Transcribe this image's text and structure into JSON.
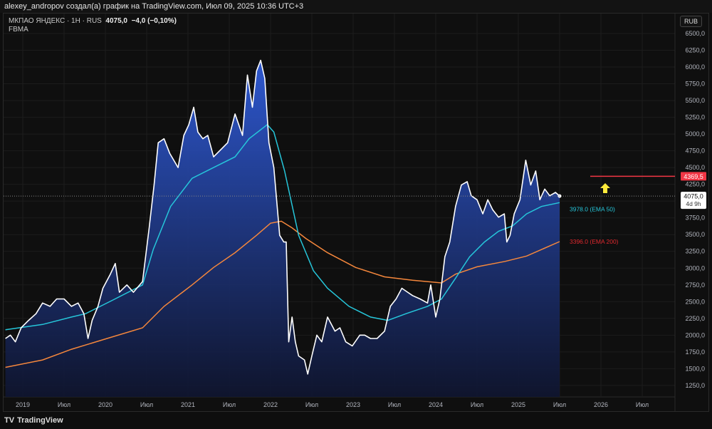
{
  "header": {
    "caption": "alexey_andropov создал(а) график на TradingView.com, Июл 09, 2025 10:36 UTC+3"
  },
  "legend": {
    "symbol": "МКПАО ЯНДЕКС · 1Н · RUS",
    "price": "4075,0",
    "change": "−4,0 (−0,10%)",
    "indicator": "FBMA"
  },
  "currency": "RUB",
  "footer": {
    "brand": "TradingView"
  },
  "colors": {
    "price": "#ffffff",
    "ema50": "#26c6da",
    "ema200": "#f5873c",
    "alert": "#f23645",
    "arrow": "#ffeb3b",
    "fill_top": "#2f5bd8",
    "fill_bottom": "#0f1530"
  },
  "chart_data": {
    "type": "area",
    "ylim": [
      1125,
      6600
    ],
    "y_ticks": [
      "6500,0",
      "6250,0",
      "6000,0",
      "5750,0",
      "5500,0",
      "5250,0",
      "5000,0",
      "4750,0",
      "4500,0",
      "4250,0",
      "4000,0",
      "3750,0",
      "3500,0",
      "3250,0",
      "3000,0",
      "2750,0",
      "2500,0",
      "2250,0",
      "2000,0",
      "1750,0",
      "1500,0",
      "1250,0"
    ],
    "y_tick_values": [
      6500,
      6250,
      6000,
      5750,
      5500,
      5250,
      5000,
      4750,
      4500,
      4250,
      4000,
      3750,
      3500,
      3250,
      3000,
      2750,
      2500,
      2250,
      2000,
      1750,
      1500,
      1250
    ],
    "x_ticks": [
      {
        "t": 2019.0,
        "label": "2019"
      },
      {
        "t": 2019.5,
        "label": "Июл"
      },
      {
        "t": 2020.0,
        "label": "2020"
      },
      {
        "t": 2020.5,
        "label": "Июл"
      },
      {
        "t": 2021.0,
        "label": "2021"
      },
      {
        "t": 2021.5,
        "label": "Июл"
      },
      {
        "t": 2022.0,
        "label": "2022"
      },
      {
        "t": 2022.5,
        "label": "Июл"
      },
      {
        "t": 2023.0,
        "label": "2023"
      },
      {
        "t": 2023.5,
        "label": "Июл"
      },
      {
        "t": 2024.0,
        "label": "2024"
      },
      {
        "t": 2024.5,
        "label": "Июл"
      },
      {
        "t": 2025.0,
        "label": "2025"
      },
      {
        "t": 2025.5,
        "label": "Июл"
      },
      {
        "t": 2026.0,
        "label": "2026"
      },
      {
        "t": 2026.5,
        "label": "Июл"
      }
    ],
    "price": [
      [
        2018.79,
        1950
      ],
      [
        2018.85,
        2000
      ],
      [
        2018.91,
        1900
      ],
      [
        2018.98,
        2110
      ],
      [
        2019.07,
        2220
      ],
      [
        2019.16,
        2320
      ],
      [
        2019.24,
        2480
      ],
      [
        2019.33,
        2430
      ],
      [
        2019.41,
        2540
      ],
      [
        2019.5,
        2540
      ],
      [
        2019.59,
        2430
      ],
      [
        2019.67,
        2480
      ],
      [
        2019.74,
        2320
      ],
      [
        2019.79,
        1950
      ],
      [
        2019.84,
        2220
      ],
      [
        2019.91,
        2430
      ],
      [
        2019.97,
        2700
      ],
      [
        2020.06,
        2910
      ],
      [
        2020.12,
        3070
      ],
      [
        2020.17,
        2640
      ],
      [
        2020.26,
        2750
      ],
      [
        2020.34,
        2640
      ],
      [
        2020.45,
        2800
      ],
      [
        2020.53,
        3600
      ],
      [
        2020.59,
        4240
      ],
      [
        2020.64,
        4870
      ],
      [
        2020.71,
        4930
      ],
      [
        2020.78,
        4710
      ],
      [
        2020.88,
        4500
      ],
      [
        2020.95,
        4980
      ],
      [
        2021.01,
        5140
      ],
      [
        2021.07,
        5400
      ],
      [
        2021.12,
        5030
      ],
      [
        2021.18,
        4930
      ],
      [
        2021.24,
        4980
      ],
      [
        2021.31,
        4660
      ],
      [
        2021.4,
        4770
      ],
      [
        2021.48,
        4870
      ],
      [
        2021.57,
        5300
      ],
      [
        2021.66,
        4980
      ],
      [
        2021.72,
        5880
      ],
      [
        2021.78,
        5400
      ],
      [
        2021.83,
        5940
      ],
      [
        2021.88,
        6100
      ],
      [
        2021.93,
        5830
      ],
      [
        2021.98,
        4870
      ],
      [
        2022.04,
        4500
      ],
      [
        2022.11,
        3490
      ],
      [
        2022.16,
        3390
      ],
      [
        2022.19,
        3390
      ],
      [
        2022.22,
        1900
      ],
      [
        2022.26,
        2270
      ],
      [
        2022.3,
        1900
      ],
      [
        2022.34,
        1690
      ],
      [
        2022.41,
        1630
      ],
      [
        2022.45,
        1420
      ],
      [
        2022.5,
        1690
      ],
      [
        2022.56,
        2000
      ],
      [
        2022.62,
        1900
      ],
      [
        2022.69,
        2270
      ],
      [
        2022.78,
        2060
      ],
      [
        2022.84,
        2110
      ],
      [
        2022.91,
        1900
      ],
      [
        2022.99,
        1840
      ],
      [
        2023.08,
        2000
      ],
      [
        2023.14,
        2000
      ],
      [
        2023.21,
        1950
      ],
      [
        2023.29,
        1950
      ],
      [
        2023.38,
        2060
      ],
      [
        2023.45,
        2430
      ],
      [
        2023.52,
        2540
      ],
      [
        2023.59,
        2700
      ],
      [
        2023.66,
        2640
      ],
      [
        2023.72,
        2590
      ],
      [
        2023.81,
        2540
      ],
      [
        2023.9,
        2480
      ],
      [
        2023.94,
        2750
      ],
      [
        2024.0,
        2270
      ],
      [
        2024.05,
        2540
      ],
      [
        2024.11,
        3170
      ],
      [
        2024.17,
        3390
      ],
      [
        2024.24,
        3920
      ],
      [
        2024.31,
        4240
      ],
      [
        2024.38,
        4290
      ],
      [
        2024.43,
        4080
      ],
      [
        2024.5,
        4020
      ],
      [
        2024.57,
        3810
      ],
      [
        2024.63,
        4020
      ],
      [
        2024.69,
        3870
      ],
      [
        2024.76,
        3760
      ],
      [
        2024.83,
        3810
      ],
      [
        2024.86,
        3390
      ],
      [
        2024.9,
        3490
      ],
      [
        2024.95,
        3810
      ],
      [
        2025.02,
        4020
      ],
      [
        2025.09,
        4610
      ],
      [
        2025.15,
        4240
      ],
      [
        2025.21,
        4450
      ],
      [
        2025.26,
        4020
      ],
      [
        2025.32,
        4180
      ],
      [
        2025.38,
        4080
      ],
      [
        2025.45,
        4130
      ],
      [
        2025.5,
        4075
      ]
    ],
    "ema50": [
      [
        2018.79,
        2080
      ],
      [
        2019.24,
        2160
      ],
      [
        2019.59,
        2270
      ],
      [
        2019.76,
        2320
      ],
      [
        2020.1,
        2530
      ],
      [
        2020.45,
        2750
      ],
      [
        2020.58,
        3280
      ],
      [
        2020.79,
        3920
      ],
      [
        2021.05,
        4340
      ],
      [
        2021.31,
        4500
      ],
      [
        2021.57,
        4660
      ],
      [
        2021.74,
        4930
      ],
      [
        2021.96,
        5140
      ],
      [
        2022.04,
        5030
      ],
      [
        2022.17,
        4450
      ],
      [
        2022.34,
        3490
      ],
      [
        2022.52,
        2960
      ],
      [
        2022.69,
        2700
      ],
      [
        2022.95,
        2430
      ],
      [
        2023.21,
        2270
      ],
      [
        2023.42,
        2220
      ],
      [
        2023.64,
        2320
      ],
      [
        2023.9,
        2430
      ],
      [
        2024.07,
        2540
      ],
      [
        2024.24,
        2850
      ],
      [
        2024.41,
        3170
      ],
      [
        2024.59,
        3390
      ],
      [
        2024.76,
        3550
      ],
      [
        2024.93,
        3630
      ],
      [
        2025.1,
        3810
      ],
      [
        2025.28,
        3920
      ],
      [
        2025.5,
        3978
      ]
    ],
    "ema200": [
      [
        2018.79,
        1520
      ],
      [
        2019.24,
        1630
      ],
      [
        2019.59,
        1790
      ],
      [
        2020.02,
        1950
      ],
      [
        2020.45,
        2110
      ],
      [
        2020.71,
        2430
      ],
      [
        2021.05,
        2750
      ],
      [
        2021.31,
        3010
      ],
      [
        2021.57,
        3230
      ],
      [
        2021.83,
        3490
      ],
      [
        2022.0,
        3670
      ],
      [
        2022.13,
        3700
      ],
      [
        2022.26,
        3600
      ],
      [
        2022.43,
        3440
      ],
      [
        2022.69,
        3230
      ],
      [
        2023.03,
        3010
      ],
      [
        2023.38,
        2870
      ],
      [
        2023.72,
        2820
      ],
      [
        2024.07,
        2780
      ],
      [
        2024.24,
        2910
      ],
      [
        2024.5,
        3020
      ],
      [
        2024.84,
        3100
      ],
      [
        2025.1,
        3180
      ],
      [
        2025.5,
        3396
      ]
    ],
    "ema50_label": "3978.0 (EMA 50)",
    "ema200_label": "3396.0 (EMA 200)",
    "last_price": 4075,
    "last_price_label": "4075,0",
    "countdown": "4d 9h",
    "alert_level": 4369.5,
    "alert_label": "4369,5"
  }
}
